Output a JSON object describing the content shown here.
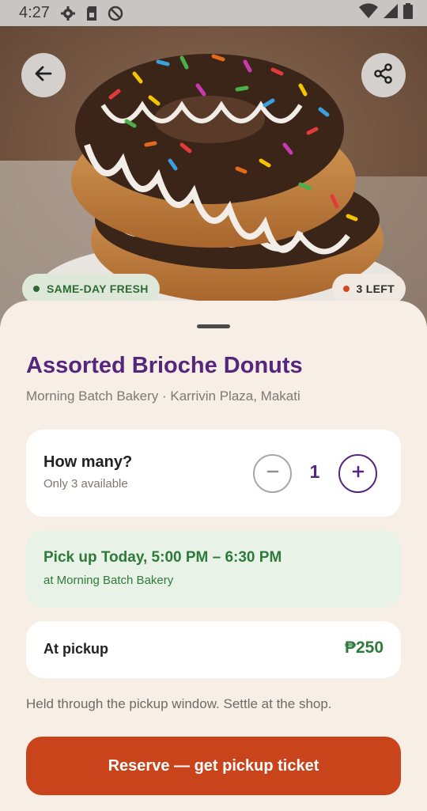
{
  "status_bar": {
    "time": "4:27",
    "icons": [
      "settings-icon",
      "sim-card-icon",
      "do-not-disturb-icon",
      "wifi-icon",
      "signal-icon",
      "battery-icon"
    ]
  },
  "hero": {
    "image": "donut-photo",
    "badge_fresh": "SAME-DAY FRESH",
    "badge_stock": "3 LEFT",
    "colors": {
      "fresh": "#2e6b34",
      "stock_dot": "#d24a1c"
    }
  },
  "product": {
    "title": "Assorted Brioche Donuts",
    "subtitle": "Morning Batch Bakery · Karrivin Plaza, Makati"
  },
  "quantity": {
    "title": "How many?",
    "availability": "Only 3 available",
    "value": "1",
    "minus_symbol": "−",
    "plus_symbol": "+"
  },
  "pickup": {
    "title": "Pick up Today, 5:00 PM – 6:30 PM",
    "location": "at Morning Batch Bakery"
  },
  "payment": {
    "label": "At pickup",
    "price": "₱250"
  },
  "note": "Held through the pickup window. Settle at the shop.",
  "cta": {
    "label": "Reserve — get pickup ticket",
    "color": "#c9431b"
  },
  "theme": {
    "accent_purple": "#55267c",
    "accent_green": "#2e7a3a",
    "sheet_bg": "#f7efe6"
  }
}
